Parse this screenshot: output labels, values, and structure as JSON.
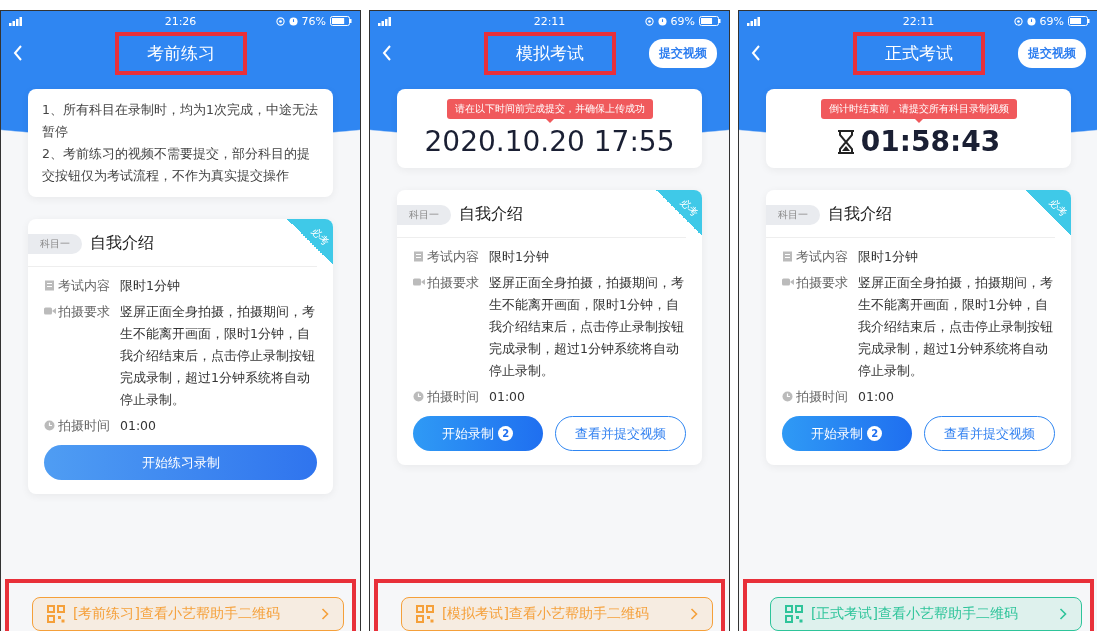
{
  "phones": [
    {
      "status_bar": {
        "time": "21:26",
        "battery": "76%"
      },
      "title": "考前练习",
      "highlighted_title": true,
      "notice": {
        "kind": "text",
        "lines": [
          "1、所有科目在录制时，均为1次完成，中途无法暂停",
          "2、考前练习的视频不需要提交，部分科目的提交按钮仅为考试流程，不作为真实提交操作"
        ]
      },
      "subject": {
        "tag": "科目一",
        "name": "自我介绍",
        "corner": "必考",
        "rows": [
          {
            "kind": "content",
            "label": "考试内容",
            "value": "限时1分钟"
          },
          {
            "kind": "requirement",
            "label": "拍摄要求",
            "value": "竖屏正面全身拍摄，拍摄期间，考生不能离开画面，限时1分钟，自我介绍结束后，点击停止录制按钮完成录制，超过1分钟系统将自动停止录制。"
          },
          {
            "kind": "time",
            "label": "拍摄时间",
            "value": "01:00"
          }
        ],
        "buttons": [
          {
            "kind": "wide",
            "label": "开始练习录制"
          }
        ]
      },
      "qr_button": {
        "label": "[考前练习]查看小艺帮助手二维码",
        "color": "#f5a03a",
        "highlighted": true
      }
    },
    {
      "status_bar": {
        "time": "22:11",
        "battery": "69%"
      },
      "title": "模拟考试",
      "highlighted_title": true,
      "header_button": "提交视频",
      "notice": {
        "kind": "deadline",
        "tip": "请在以下时间前完成提交，并确保上传成功",
        "value": "2020.10.20 17:55"
      },
      "subject": {
        "tag": "科目一",
        "name": "自我介绍",
        "corner": "必考",
        "rows": [
          {
            "kind": "content",
            "label": "考试内容",
            "value": "限时1分钟"
          },
          {
            "kind": "requirement",
            "label": "拍摄要求",
            "value": "竖屏正面全身拍摄，拍摄期间，考生不能离开画面，限时1分钟，自我介绍结束后，点击停止录制按钮完成录制，超过1分钟系统将自动停止录制。"
          },
          {
            "kind": "time",
            "label": "拍摄时间",
            "value": "01:00"
          }
        ],
        "buttons": [
          {
            "kind": "primary",
            "label": "开始录制",
            "badge": "2"
          },
          {
            "kind": "outline",
            "label": "查看并提交视频"
          }
        ]
      },
      "qr_button": {
        "label": "[模拟考试]查看小艺帮助手二维码",
        "color": "#f5a03a",
        "highlighted": true
      }
    },
    {
      "status_bar": {
        "time": "22:11",
        "battery": "69%"
      },
      "title": "正式考试",
      "highlighted_title": true,
      "header_button": "提交视频",
      "notice": {
        "kind": "countdown",
        "tip": "倒计时结束前，请提交所有科目录制视频",
        "value": "01:58:43"
      },
      "subject": {
        "tag": "科目一",
        "name": "自我介绍",
        "corner": "必考",
        "rows": [
          {
            "kind": "content",
            "label": "考试内容",
            "value": "限时1分钟"
          },
          {
            "kind": "requirement",
            "label": "拍摄要求",
            "value": "竖屏正面全身拍摄，拍摄期间，考生不能离开画面，限时1分钟，自我介绍结束后，点击停止录制按钮完成录制，超过1分钟系统将自动停止录制。"
          },
          {
            "kind": "time",
            "label": "拍摄时间",
            "value": "01:00"
          }
        ],
        "buttons": [
          {
            "kind": "primary",
            "label": "开始录制",
            "badge": "2"
          },
          {
            "kind": "outline",
            "label": "查看并提交视频"
          }
        ]
      },
      "qr_button": {
        "label": "[正式考试]查看小艺帮助手二维码",
        "color": "#2ec49a",
        "highlighted": true
      }
    }
  ]
}
